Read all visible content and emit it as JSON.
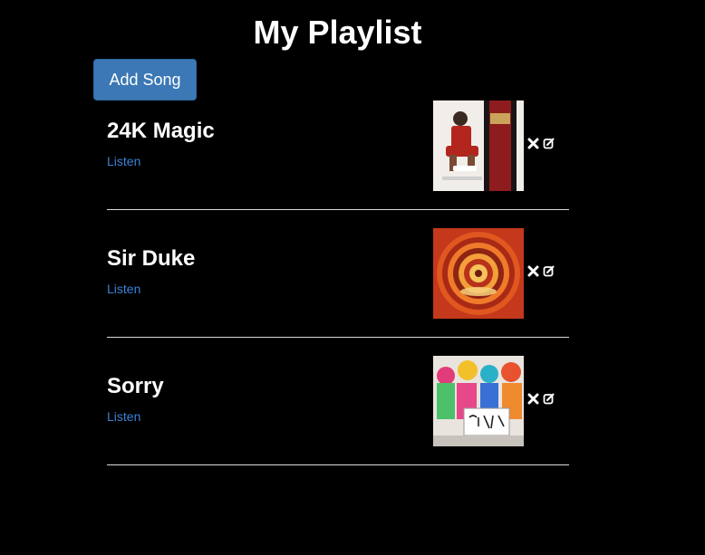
{
  "page": {
    "title": "My Playlist"
  },
  "toolbar": {
    "add_label": "Add Song"
  },
  "songs": [
    {
      "name": "24K Magic",
      "listen_label": "Listen",
      "cover": "24k-magic-album-cover"
    },
    {
      "name": "Sir Duke",
      "listen_label": "Listen",
      "cover": "songs-in-the-key-of-life-album-cover"
    },
    {
      "name": "Sorry",
      "listen_label": "Listen",
      "cover": "sorry-single-cover"
    }
  ],
  "icons": {
    "delete": "close-icon",
    "edit": "edit-icon"
  },
  "colors": {
    "background": "#000000",
    "button": "#3b78b5",
    "link": "#3b82d6",
    "divider": "#d9d9d9"
  }
}
